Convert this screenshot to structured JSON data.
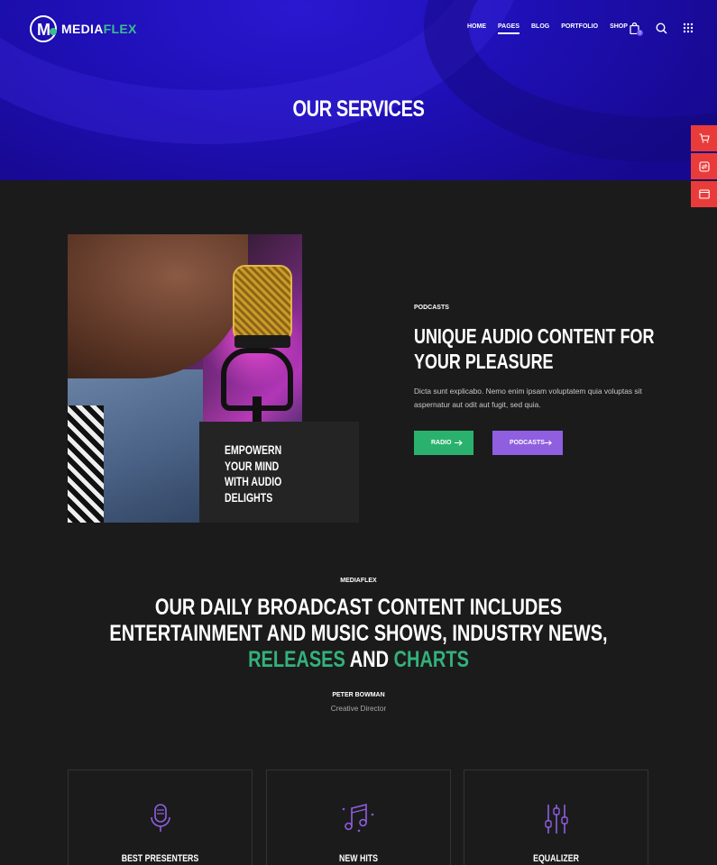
{
  "brand": {
    "logo_letter": "M",
    "name_part1": "MEDIA",
    "name_part2": "FLEX"
  },
  "nav": {
    "items": [
      "HOME",
      "PAGES",
      "BLOG",
      "PORTFOLIO",
      "SHOP"
    ],
    "active": "PAGES"
  },
  "header_icons": {
    "cart": "bag-icon",
    "cart_count": "0",
    "search": "search-icon",
    "menu": "grid-menu-icon"
  },
  "hero": {
    "title": "OUR SERVICES"
  },
  "side_buttons": [
    "cart-icon",
    "switch-icon",
    "window-icon"
  ],
  "feature": {
    "image_alt": "Singer with gold microphone",
    "quote_lines": [
      "EMPOWERN",
      "YOUR MIND",
      "WITH AUDIO",
      "DELIGHTS"
    ],
    "tag": "PODCASTS",
    "title_lines": [
      "UNIQUE AUDIO CONTENT FOR",
      "YOUR PLEASURE"
    ],
    "description": "Dicta sunt explicabo. Nemo enim ipsam voluptatem quia voluptas sit aspernatur aut odit aut fugit, sed quia.",
    "button_radio": "RADIO",
    "button_podcasts": "PODCASTS"
  },
  "broadcast": {
    "tag": "MEDIAFLEX",
    "line1": "OUR DAILY BROADCAST CONTENT INCLUDES",
    "line2": "ENTERTAINMENT AND MUSIC SHOWS, INDUSTRY NEWS,",
    "line3_a": "RELEASES",
    "line3_b": " AND ",
    "line3_c": "CHARTS",
    "author": "PETER BOWMAN",
    "role": "Creative Director"
  },
  "cards": [
    {
      "icon": "microphone-icon",
      "label": "BEST PRESENTERS"
    },
    {
      "icon": "music-notes-icon",
      "label": "NEW HITS"
    },
    {
      "icon": "equalizer-icon",
      "label": "EQUALIZER"
    }
  ],
  "colors": {
    "hero": "#1f10b8",
    "background": "#1b1b1c",
    "green": "#33b27a",
    "purple": "#8f5fe0",
    "side_red": "#ea3b3b"
  }
}
